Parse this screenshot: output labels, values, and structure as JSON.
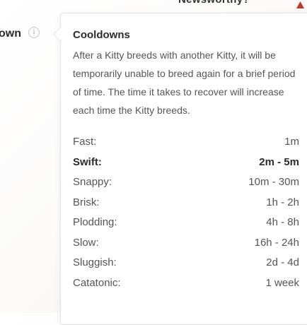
{
  "header": {
    "link_label": "Newsworthy?"
  },
  "side": {
    "label": "own",
    "info_icon": "i"
  },
  "tooltip": {
    "title": "Cooldowns",
    "description": "After a Kitty breeds with another Kitty, it will be temporarily unable to breed again for a brief period of time. The time it takes to recover will increase each time the Kitty breeds.",
    "speeds": [
      {
        "name": "Fast:",
        "value": "1m",
        "bold": false
      },
      {
        "name": "Swift:",
        "value": "2m - 5m",
        "bold": true
      },
      {
        "name": "Snappy:",
        "value": "10m - 30m",
        "bold": false
      },
      {
        "name": "Brisk:",
        "value": "1h - 2h",
        "bold": false
      },
      {
        "name": "Plodding:",
        "value": "4h - 8h",
        "bold": false
      },
      {
        "name": "Slow:",
        "value": "16h - 24h",
        "bold": false
      },
      {
        "name": "Sluggish:",
        "value": "2d - 4d",
        "bold": false
      },
      {
        "name": "Catatonic:",
        "value": "1 week",
        "bold": false
      }
    ]
  },
  "colors": {
    "accent": "#c0392b",
    "text_dark": "#2b2b2b",
    "text_muted": "#555555"
  }
}
